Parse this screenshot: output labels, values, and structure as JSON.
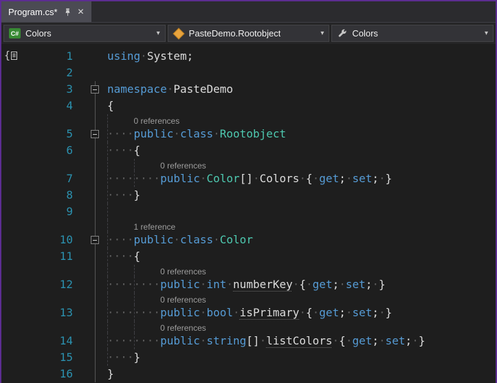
{
  "window": {
    "title": "Program.cs*"
  },
  "tab_bar": {
    "tab": {
      "title": "Program.cs*"
    },
    "close_icon": "✕"
  },
  "nav_bar": {
    "project_dropdown": {
      "label": "Colors",
      "icon": "csharp-project-icon"
    },
    "type_dropdown": {
      "label": "PasteDemo.Rootobject",
      "icon": "class-icon"
    },
    "member_dropdown": {
      "label": "Colors",
      "icon": "wrench-icon"
    },
    "chevron": "▾"
  },
  "editor": {
    "colors": {
      "background": "#1E1E1E",
      "accent_border": "#5C2D91",
      "line_number": "#2B91AF",
      "keyword": "#569CD6",
      "type": "#4EC9B0",
      "identifier": "#DCDCDC",
      "punctuation": "#DCDCDC",
      "whitespace_dot": "#5E5E5E",
      "codelens": "#9D9D9D"
    },
    "lines": [
      {
        "num": "1",
        "fold": null,
        "guides": [],
        "lens": null,
        "tokens": [
          [
            "kw",
            "using"
          ],
          [
            "ws",
            "·"
          ],
          [
            "id",
            "System"
          ],
          [
            "pn",
            ";"
          ]
        ]
      },
      {
        "num": "2",
        "fold": null,
        "guides": [],
        "lens": null,
        "tokens": []
      },
      {
        "num": "3",
        "fold": "box",
        "guides": [],
        "lens": null,
        "tokens": [
          [
            "kw",
            "namespace"
          ],
          [
            "ws",
            "·"
          ],
          [
            "id",
            "PasteDemo"
          ]
        ]
      },
      {
        "num": "4",
        "fold": "line",
        "guides": [],
        "lens": null,
        "tokens": [
          [
            "pn",
            "{"
          ]
        ]
      },
      {
        "num": "5",
        "fold": "box",
        "guides": [
          0
        ],
        "lens": {
          "text": "0 references",
          "indent": 4
        },
        "tokens": [
          [
            "ws",
            "····"
          ],
          [
            "kw",
            "public"
          ],
          [
            "ws",
            "·"
          ],
          [
            "kw",
            "class"
          ],
          [
            "ws",
            "·"
          ],
          [
            "ty",
            "Rootobject"
          ]
        ]
      },
      {
        "num": "6",
        "fold": "line",
        "guides": [
          0
        ],
        "lens": null,
        "tokens": [
          [
            "ws",
            "····"
          ],
          [
            "pn",
            "{"
          ]
        ]
      },
      {
        "num": "7",
        "fold": "line",
        "guides": [
          0,
          1
        ],
        "lens": {
          "text": "0 references",
          "indent": 8
        },
        "tokens": [
          [
            "ws",
            "········"
          ],
          [
            "kw",
            "public"
          ],
          [
            "ws",
            "·"
          ],
          [
            "ty",
            "Color"
          ],
          [
            "pn",
            "[]"
          ],
          [
            "ws",
            "·"
          ],
          [
            "id",
            "Colors"
          ],
          [
            "ws",
            "·"
          ],
          [
            "pn",
            "{"
          ],
          [
            "ws",
            "·"
          ],
          [
            "kw",
            "get"
          ],
          [
            "pn",
            ";"
          ],
          [
            "ws",
            "·"
          ],
          [
            "kw",
            "set"
          ],
          [
            "pn",
            ";"
          ],
          [
            "ws",
            "·"
          ],
          [
            "pn",
            "}"
          ]
        ]
      },
      {
        "num": "8",
        "fold": "line",
        "guides": [
          0
        ],
        "lens": null,
        "tokens": [
          [
            "ws",
            "····"
          ],
          [
            "pn",
            "}"
          ]
        ]
      },
      {
        "num": "9",
        "fold": "line",
        "guides": [
          0
        ],
        "lens": null,
        "tokens": []
      },
      {
        "num": "10",
        "fold": "box",
        "guides": [
          0
        ],
        "lens": {
          "text": "1 reference",
          "indent": 4
        },
        "tokens": [
          [
            "ws",
            "····"
          ],
          [
            "kw",
            "public"
          ],
          [
            "ws",
            "·"
          ],
          [
            "kw",
            "class"
          ],
          [
            "ws",
            "·"
          ],
          [
            "ty",
            "Color"
          ]
        ]
      },
      {
        "num": "11",
        "fold": "line",
        "guides": [
          0
        ],
        "lens": null,
        "tokens": [
          [
            "ws",
            "····"
          ],
          [
            "pn",
            "{"
          ]
        ]
      },
      {
        "num": "12",
        "fold": "line",
        "guides": [
          0,
          1
        ],
        "lens": {
          "text": "0 references",
          "indent": 8
        },
        "tokens": [
          [
            "ws",
            "········"
          ],
          [
            "kw",
            "public"
          ],
          [
            "ws",
            "·"
          ],
          [
            "kw",
            "int"
          ],
          [
            "ws",
            "·"
          ],
          [
            "su",
            "numberKey"
          ],
          [
            "ws",
            "·"
          ],
          [
            "pn",
            "{"
          ],
          [
            "ws",
            "·"
          ],
          [
            "kw",
            "get"
          ],
          [
            "pn",
            ";"
          ],
          [
            "ws",
            "·"
          ],
          [
            "kw",
            "set"
          ],
          [
            "pn",
            ";"
          ],
          [
            "ws",
            "·"
          ],
          [
            "pn",
            "}"
          ]
        ]
      },
      {
        "num": "13",
        "fold": "line",
        "guides": [
          0,
          1
        ],
        "lens": {
          "text": "0 references",
          "indent": 8
        },
        "tokens": [
          [
            "ws",
            "········"
          ],
          [
            "kw",
            "public"
          ],
          [
            "ws",
            "·"
          ],
          [
            "kw",
            "bool"
          ],
          [
            "ws",
            "·"
          ],
          [
            "su",
            "isPrimary"
          ],
          [
            "ws",
            "·"
          ],
          [
            "pn",
            "{"
          ],
          [
            "ws",
            "·"
          ],
          [
            "kw",
            "get"
          ],
          [
            "pn",
            ";"
          ],
          [
            "ws",
            "·"
          ],
          [
            "kw",
            "set"
          ],
          [
            "pn",
            ";"
          ],
          [
            "ws",
            "·"
          ],
          [
            "pn",
            "}"
          ]
        ]
      },
      {
        "num": "14",
        "fold": "line",
        "guides": [
          0,
          1
        ],
        "lens": {
          "text": "0 references",
          "indent": 8
        },
        "tokens": [
          [
            "ws",
            "········"
          ],
          [
            "kw",
            "public"
          ],
          [
            "ws",
            "·"
          ],
          [
            "kw",
            "string"
          ],
          [
            "pn",
            "[]"
          ],
          [
            "ws",
            "·"
          ],
          [
            "su",
            "listColors"
          ],
          [
            "ws",
            "·"
          ],
          [
            "pn",
            "{"
          ],
          [
            "ws",
            "·"
          ],
          [
            "kw",
            "get"
          ],
          [
            "pn",
            ";"
          ],
          [
            "ws",
            "·"
          ],
          [
            "kw",
            "set"
          ],
          [
            "pn",
            ";"
          ],
          [
            "ws",
            "·"
          ],
          [
            "pn",
            "}"
          ]
        ]
      },
      {
        "num": "15",
        "fold": "line",
        "guides": [
          0
        ],
        "lens": null,
        "tokens": [
          [
            "ws",
            "····"
          ],
          [
            "pn",
            "}"
          ]
        ]
      },
      {
        "num": "16",
        "fold": "line",
        "guides": [],
        "lens": null,
        "tokens": [
          [
            "pn",
            "}"
          ]
        ]
      }
    ]
  }
}
